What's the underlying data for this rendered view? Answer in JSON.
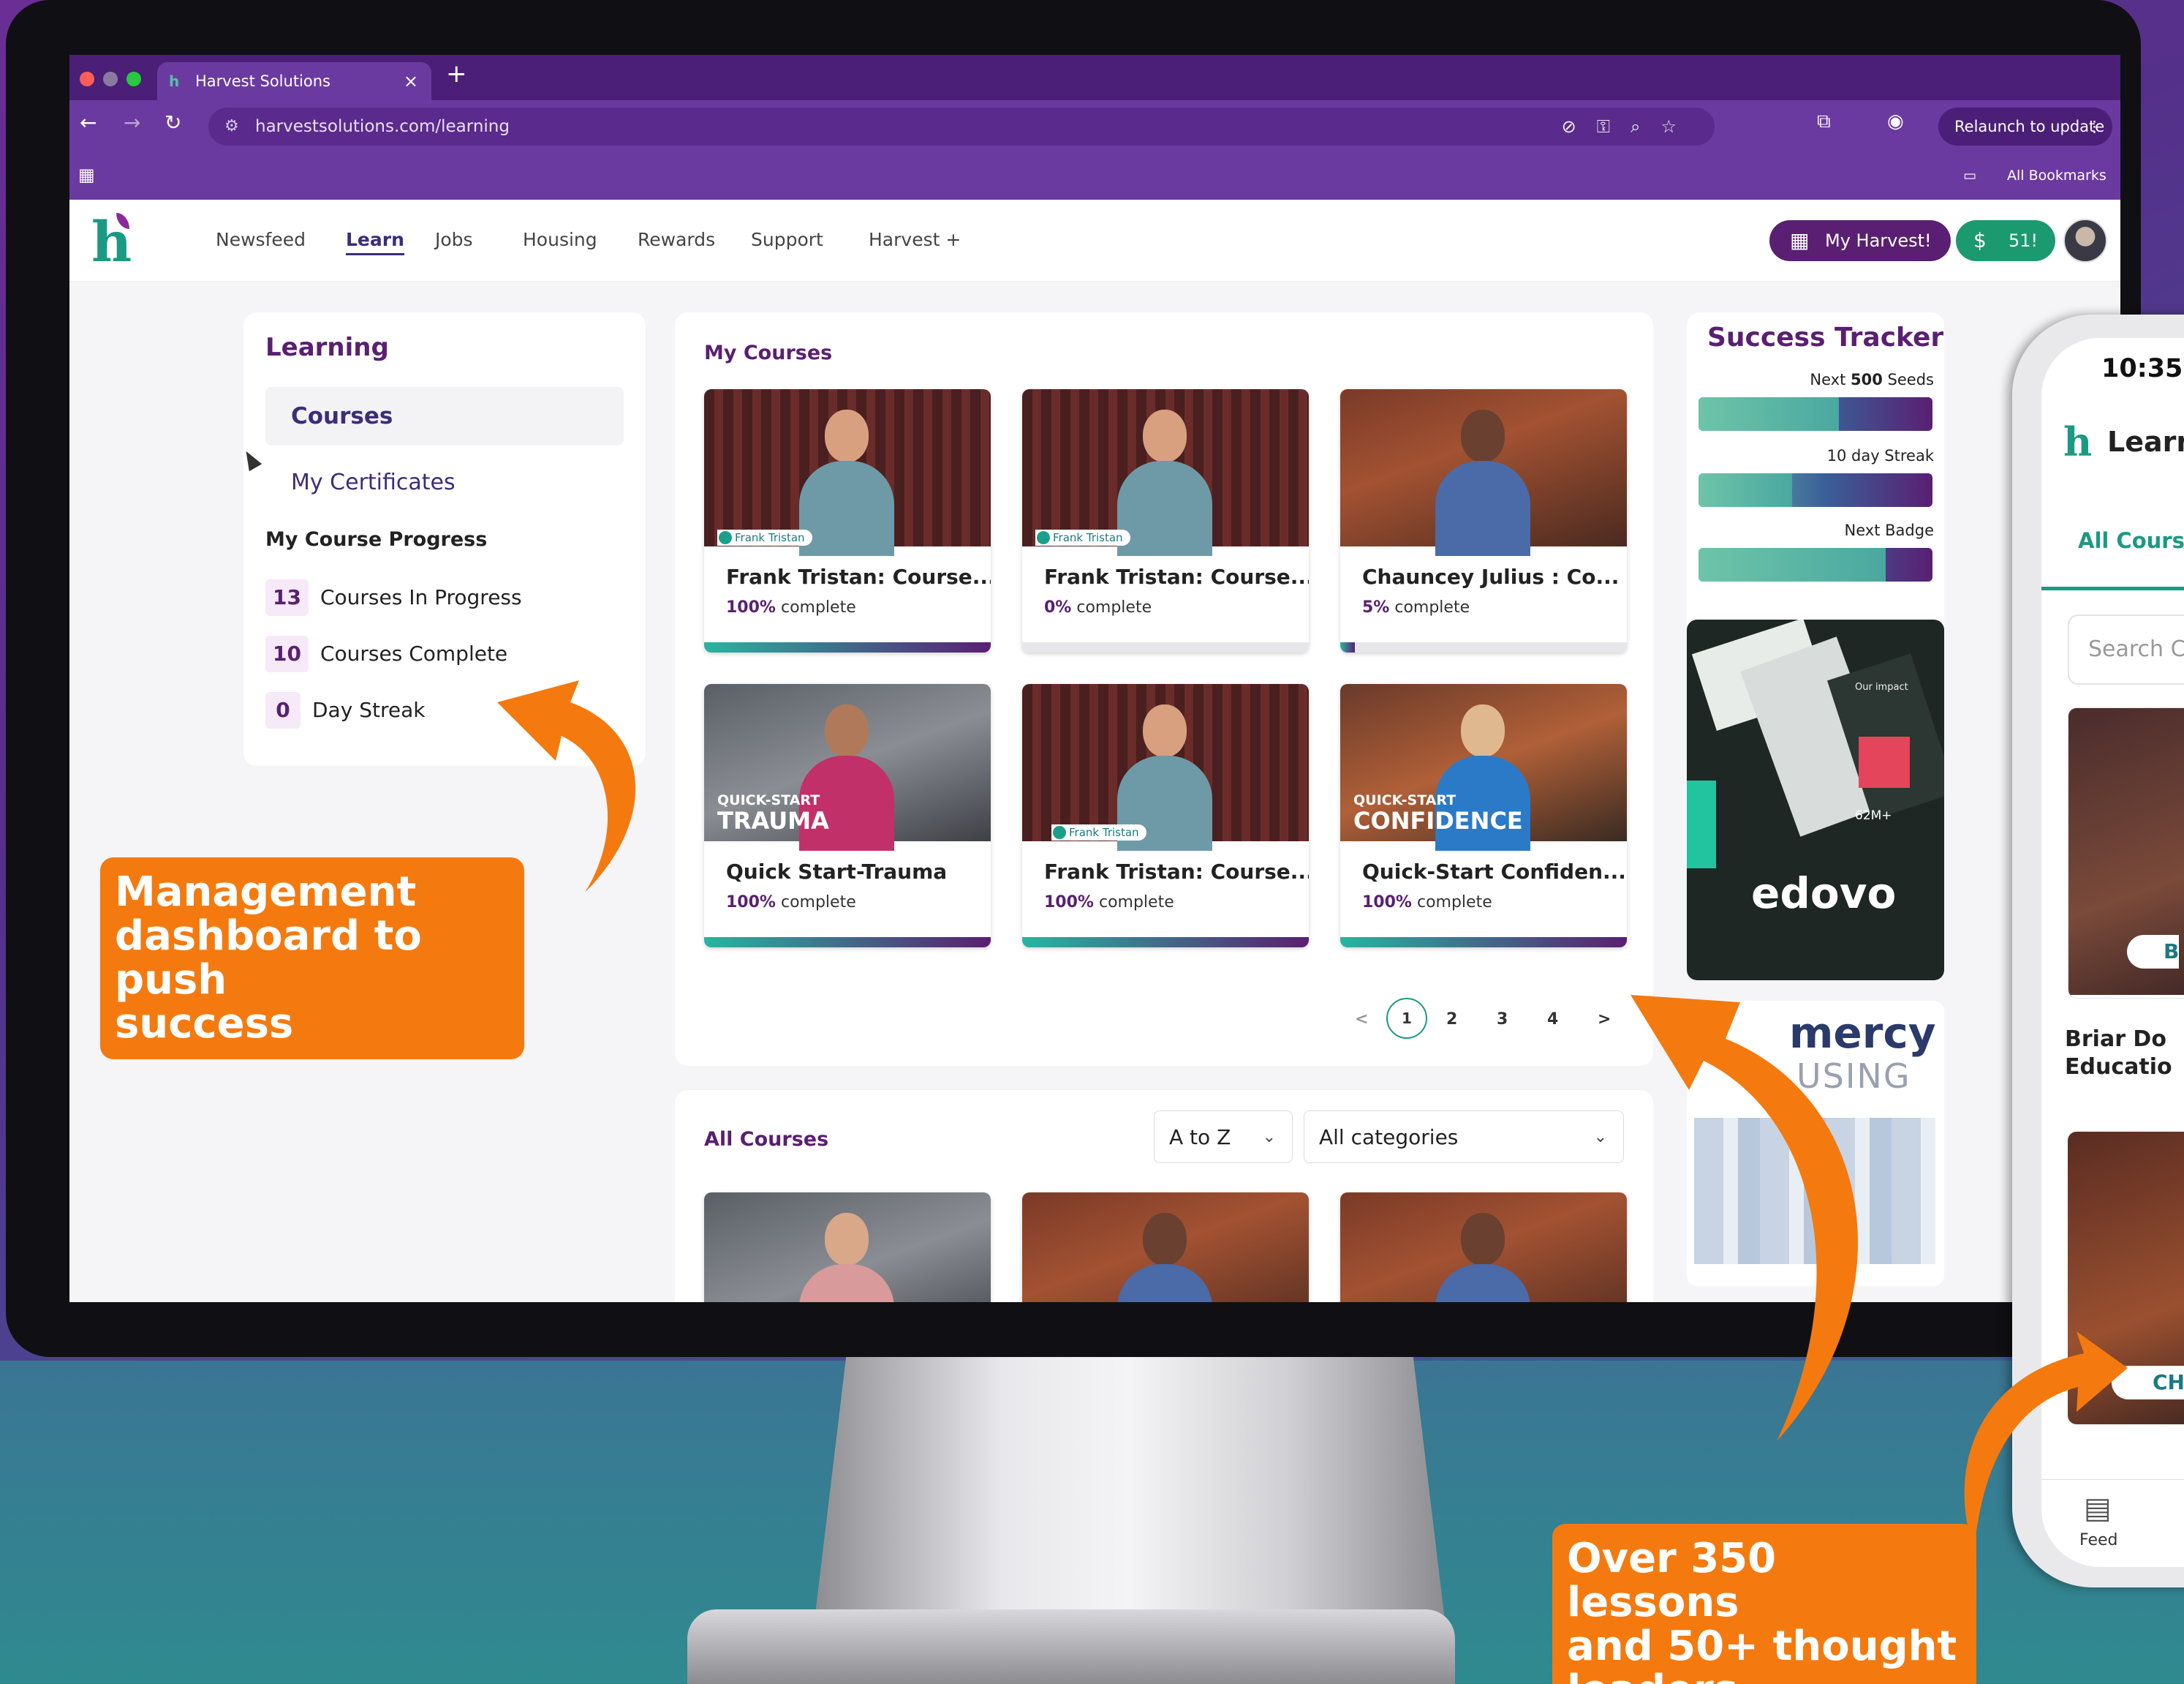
{
  "browser": {
    "tab_title": "Harvest Solutions",
    "url": "harvestsolutions.com/learning",
    "relaunch_label": "Relaunch to update",
    "bookmarks_label": "All Bookmarks"
  },
  "appnav": {
    "items": [
      "Newsfeed",
      "Learn",
      "Jobs",
      "Housing",
      "Rewards",
      "Support",
      "Harvest +"
    ],
    "active": "Learn",
    "my_harvest_label": "My Harvest!",
    "coins_label": "51!"
  },
  "learning": {
    "title": "Learning",
    "courses_label": "Courses",
    "certificates_label": "My Certificates",
    "progress_title": "My Course Progress",
    "stats": [
      {
        "count": "13",
        "label": "Courses In Progress"
      },
      {
        "count": "10",
        "label": "Courses Complete"
      },
      {
        "count": "0",
        "label": "Day Streak"
      }
    ]
  },
  "my_courses": {
    "title": "My Courses",
    "cards": [
      {
        "title": "Frank Tristan: Course...",
        "percent": "100%",
        "suffix": "complete",
        "progress": 1.0,
        "tag": "Frank Tristan"
      },
      {
        "title": "Frank Tristan: Course...",
        "percent": "0%",
        "suffix": "complete",
        "progress": 0.0,
        "tag": "Frank Tristan"
      },
      {
        "title": "Chauncey Julius : Co...",
        "percent": "5%",
        "suffix": "complete",
        "progress": 0.05,
        "tag": ""
      },
      {
        "title": "Quick Start-Trauma",
        "percent": "100%",
        "suffix": "complete",
        "progress": 1.0,
        "overlay_small": "QUICK-START",
        "overlay_big": "TRAUMA"
      },
      {
        "title": "Frank Tristan: Course...",
        "percent": "100%",
        "suffix": "complete",
        "progress": 1.0,
        "tag": "Frank Tristan"
      },
      {
        "title": "Quick-Start Confiden...",
        "percent": "100%",
        "suffix": "complete",
        "progress": 1.0,
        "overlay_small": "QUICK-START",
        "overlay_big": "CONFIDENCE"
      }
    ],
    "pager": {
      "prev": "<",
      "pages": [
        "1",
        "2",
        "3",
        "4"
      ],
      "active": "1",
      "next": ">"
    }
  },
  "all_courses": {
    "title": "All Courses",
    "sort_value": "A to Z",
    "category_value": "All categories"
  },
  "tracker": {
    "title": "Success Tracker",
    "items": [
      {
        "label_pre": "Next ",
        "label_bold": "500",
        "label_post": " Seeds",
        "level": 0.6
      },
      {
        "label_pre": "",
        "label_bold": "",
        "label_post": "10 day Streak",
        "level": 0.4
      },
      {
        "label_pre": "",
        "label_bold": "",
        "label_post": "Next Badge",
        "level": 0.8
      }
    ]
  },
  "promos": {
    "edovo": {
      "brand": "edovo",
      "stat": "62M+",
      "impact": "Our impact"
    },
    "mercy": {
      "line1": "mercy",
      "line2": "USING"
    }
  },
  "phone": {
    "time": "10:35",
    "title": "Learn",
    "tab": "All Course",
    "search_placeholder": "Search C",
    "card1_badge": "B",
    "card1_title_l1": "Briar Do",
    "card1_title_l2": "Educatio",
    "card2_badge": "CH",
    "nav_feed": "Feed"
  },
  "callouts": {
    "left": [
      "Management",
      "dashboard to push",
      "success"
    ],
    "right": [
      "Over 350 lessons",
      "and 50+ thought",
      "leaders"
    ]
  },
  "colors": {
    "brand_purple": "#5a1f72",
    "brand_green": "#1a9a82",
    "callout_orange": "#f47a0f",
    "chrome_purple": "#6b3aa0"
  }
}
